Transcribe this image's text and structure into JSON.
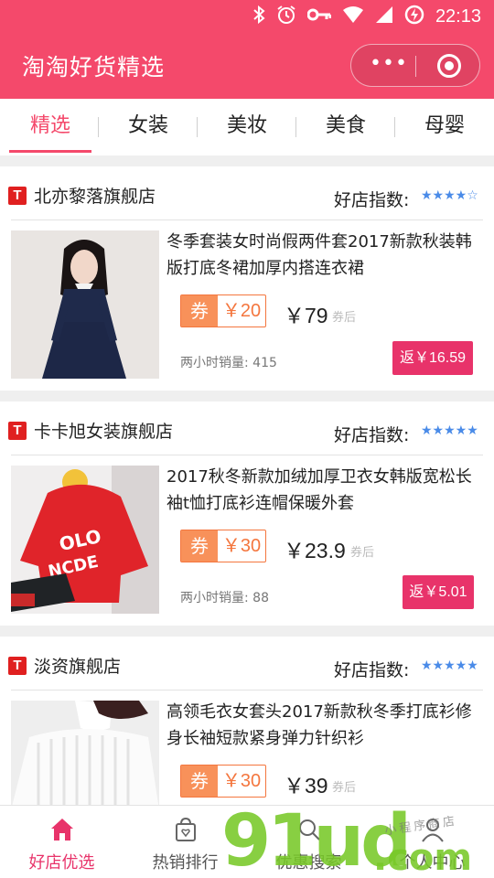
{
  "status_bar": {
    "time": "22:13",
    "icons": [
      "bluetooth-icon",
      "alarm-icon",
      "key-icon",
      "wifi-icon",
      "signal-icon",
      "battery-charging-icon"
    ]
  },
  "nav": {
    "title": "淘淘好货精选",
    "more_glyph": "•••",
    "brand_color": "#f4496b"
  },
  "tabs": [
    {
      "label": "精选",
      "active": true
    },
    {
      "label": "女装",
      "active": false
    },
    {
      "label": "美妆",
      "active": false
    },
    {
      "label": "美食",
      "active": false
    },
    {
      "label": "母婴",
      "active": false
    }
  ],
  "rating_label": "好店指数:",
  "coupon_tag": "券",
  "after_coupon": "券后",
  "sales_label": "两小时销量:",
  "shops": [
    {
      "logo": "T",
      "name": "北亦黎落旗舰店",
      "stars_filled": 4,
      "stars_text": "★★★★☆",
      "product": {
        "title": "冬季套装女时尚假两件套2017新款秋装韩版打底冬裙加厚内搭连衣裙",
        "coupon_amount": "￥20",
        "price": "￥79",
        "sales": "415",
        "rebate": "返￥16.59"
      }
    },
    {
      "logo": "T",
      "name": "卡卡旭女装旗舰店",
      "stars_filled": 5,
      "stars_text": "★★★★★",
      "product": {
        "title": "2017秋冬新款加绒加厚卫衣女韩版宽松长袖t恤打底衫连帽保暖外套",
        "coupon_amount": "￥30",
        "price": "￥23.9",
        "sales": "88",
        "rebate": "返￥5.01"
      }
    },
    {
      "logo": "T",
      "name": "淡资旗舰店",
      "stars_filled": 5,
      "stars_text": "★★★★★",
      "product": {
        "title": "高领毛衣女套头2017新款秋冬季打底衫修身长袖短款紧身弹力针织衫",
        "coupon_amount": "￥30",
        "price": "￥39"
      }
    }
  ],
  "tabbar": [
    {
      "label": "好店优选",
      "icon": "home-icon",
      "active": true
    },
    {
      "label": "热销排行",
      "icon": "shopping-bag-icon",
      "active": false
    },
    {
      "label": "优惠搜索",
      "icon": "search-icon",
      "active": false
    },
    {
      "label": "个人中心",
      "icon": "user-icon",
      "active": false
    }
  ],
  "watermark": {
    "big": "91ud",
    "com": ".com",
    "small": "小程序商店"
  },
  "colors": {
    "accent": "#f4496b",
    "rebate": "#e8336a",
    "coupon": "#f4763e",
    "stars": "#4a8be8"
  }
}
